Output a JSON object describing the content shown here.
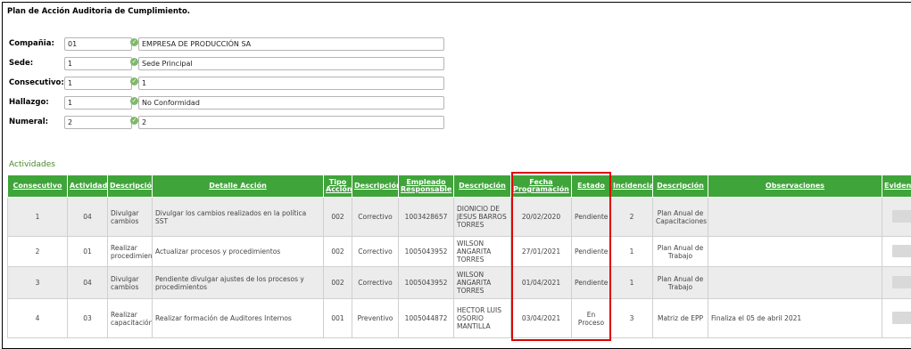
{
  "page": {
    "title": "Plan de Acción Auditoria de Cumplimiento.",
    "section_label": "Actividades"
  },
  "form": {
    "compania": {
      "label": "Compañia:",
      "code": "01",
      "desc": "EMPRESA DE PRODUCCIÓN SA"
    },
    "sede": {
      "label": "Sede:",
      "code": "1",
      "desc": "Sede Principal"
    },
    "consecutivo": {
      "label": "Consecutivo:",
      "code": "1",
      "desc": "1"
    },
    "hallazgo": {
      "label": "Hallazgo:",
      "code": "1",
      "desc": "No Conformidad"
    },
    "numeral": {
      "label": "Numeral:",
      "code": "2",
      "desc": "2"
    }
  },
  "table": {
    "headers": [
      "Consecutivo",
      "Actividad",
      "Descripción",
      "Detalle Acción",
      "Tipo Acción",
      "Descripción",
      "Empleado Responsable",
      "Descripción",
      "Fecha Programación",
      "Estado",
      "Incidencia",
      "Descripción",
      "Observaciones",
      "Evidencia"
    ],
    "rows": [
      [
        "1",
        "04",
        "Divulgar cambios",
        "Divulgar los cambios realizados en la política SST",
        "002",
        "Correctivo",
        "1003428657",
        "DIONICIO DE JESUS BARROS TORRES",
        "20/02/2020",
        "Pendiente",
        "2",
        "Plan Anual de Capacitaciones",
        ""
      ],
      [
        "2",
        "01",
        "Realizar procedimiento",
        "Actualizar procesos y procedimientos",
        "002",
        "Correctivo",
        "1005043952",
        "WILSON ANGARITA TORRES",
        "27/01/2021",
        "Pendiente",
        "1",
        "Plan Anual de Trabajo",
        ""
      ],
      [
        "3",
        "04",
        "Divulgar cambios",
        "Pendiente divulgar ajustes de los procesos y procedimientos",
        "002",
        "Correctivo",
        "1005043952",
        "WILSON ANGARITA TORRES",
        "01/04/2021",
        "Pendiente",
        "1",
        "Plan Anual de Trabajo",
        ""
      ],
      [
        "4",
        "03",
        "Realizar capacitación",
        "Realizar formación de Auditores Internos",
        "001",
        "Preventivo",
        "1005044872",
        "HECTOR LUIS OSORIO MANTILLA",
        "03/04/2021",
        "En Proceso",
        "3",
        "Matriz de EPP",
        "Finaliza el 05 de abril 2021"
      ]
    ]
  },
  "colors": {
    "header_bg": "#3fa43a",
    "highlight": "#e00000",
    "section_label": "#4a8a2b"
  }
}
